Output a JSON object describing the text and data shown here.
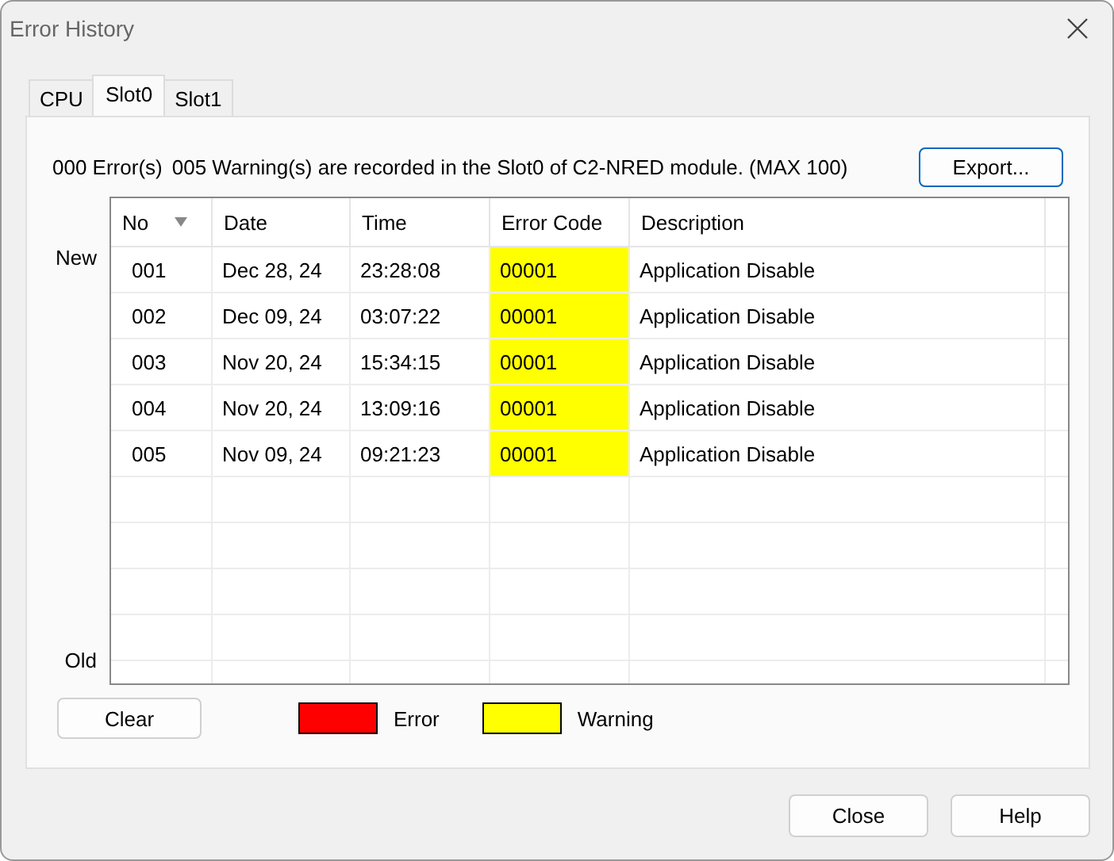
{
  "window": {
    "title": "Error History"
  },
  "tabs": [
    {
      "label": "CPU",
      "selected": false
    },
    {
      "label": "Slot0",
      "selected": true
    },
    {
      "label": "Slot1",
      "selected": false
    }
  ],
  "summary": {
    "errors": "000 Error(s)",
    "warnings": "005 Warning(s) are recorded in the Slot0 of C2-NRED module. (MAX 100)"
  },
  "export_button": "Export...",
  "order_labels": {
    "top": "New",
    "bottom": "Old"
  },
  "table": {
    "columns": [
      "No",
      "Date",
      "Time",
      "Error Code",
      "Description"
    ],
    "rows": [
      {
        "no": "001",
        "date": "Dec 28, 24",
        "time": "23:28:08",
        "code": "00001",
        "description": "Application Disable",
        "kind": "warning"
      },
      {
        "no": "002",
        "date": "Dec 09, 24",
        "time": "03:07:22",
        "code": "00001",
        "description": "Application Disable",
        "kind": "warning"
      },
      {
        "no": "003",
        "date": "Nov 20, 24",
        "time": "15:34:15",
        "code": "00001",
        "description": "Application Disable",
        "kind": "warning"
      },
      {
        "no": "004",
        "date": "Nov 20, 24",
        "time": "13:09:16",
        "code": "00001",
        "description": "Application Disable",
        "kind": "warning"
      },
      {
        "no": "005",
        "date": "Nov 09, 24",
        "time": "09:21:23",
        "code": "00001",
        "description": "Application Disable",
        "kind": "warning"
      }
    ]
  },
  "clear_button": "Clear",
  "legend": [
    {
      "label": "Error",
      "color": "#ff0000"
    },
    {
      "label": "Warning",
      "color": "#ffff00"
    }
  ],
  "buttons": [
    "Close",
    "Help"
  ]
}
